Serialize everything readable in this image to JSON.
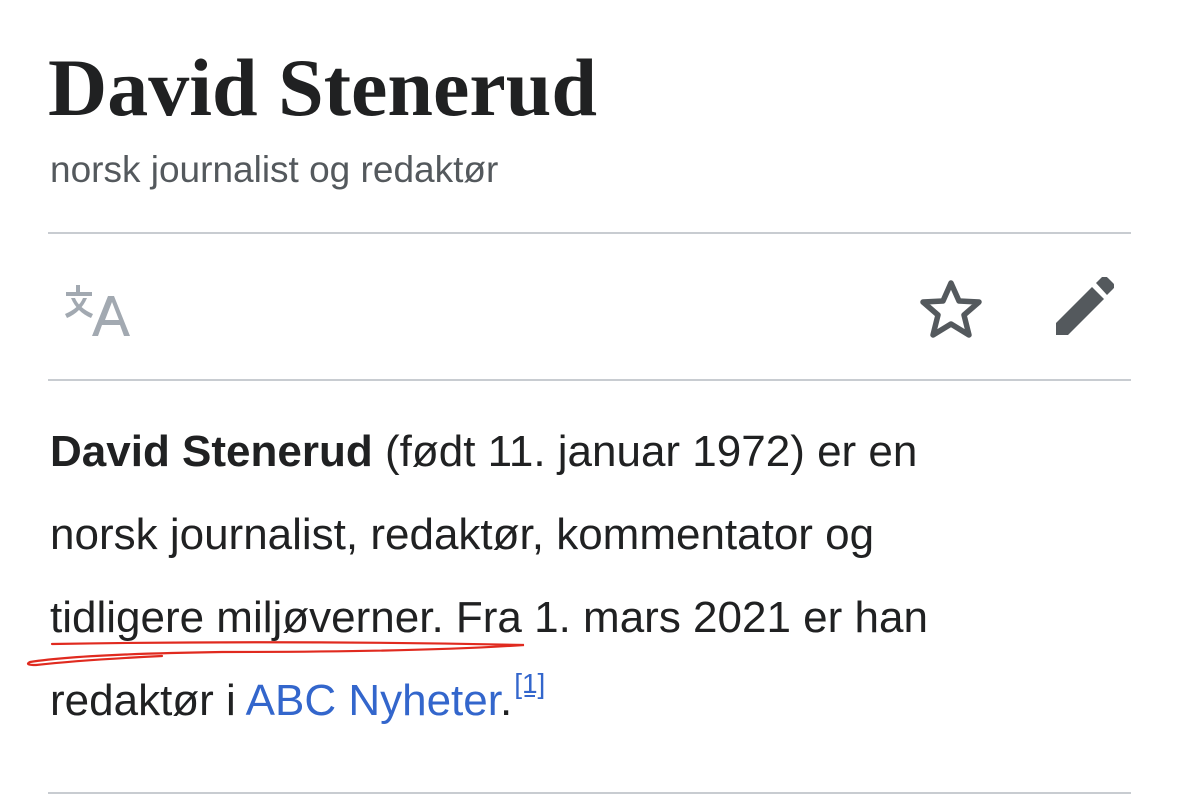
{
  "article": {
    "title": "David Stenerud",
    "subtitle": "norsk journalist og redaktør"
  },
  "toolbar": {
    "language_icon": "translate-icon",
    "watch_icon": "star-icon",
    "edit_icon": "pencil-icon"
  },
  "lead": {
    "line1": {
      "name": "David Stenerud",
      "rest": " (født 11. januar 1972) er en"
    },
    "line2": "norsk journalist, redaktør, kommentator og",
    "line3": "tidligere miljøverner. Fra 1. mars 2021 er han",
    "line4": {
      "before": "redaktør i ",
      "link": "ABC Nyheter",
      "after": ".",
      "ref": "[1]"
    }
  },
  "annotation": {
    "color": "#e02a1f",
    "type": "hand-drawn-underline"
  },
  "colors": {
    "text": "#202122",
    "subtitle": "#54595d",
    "link": "#3366cc",
    "divider": "#c8ccd1",
    "icon": "#54595d",
    "icon_muted": "#a2a9b1"
  }
}
